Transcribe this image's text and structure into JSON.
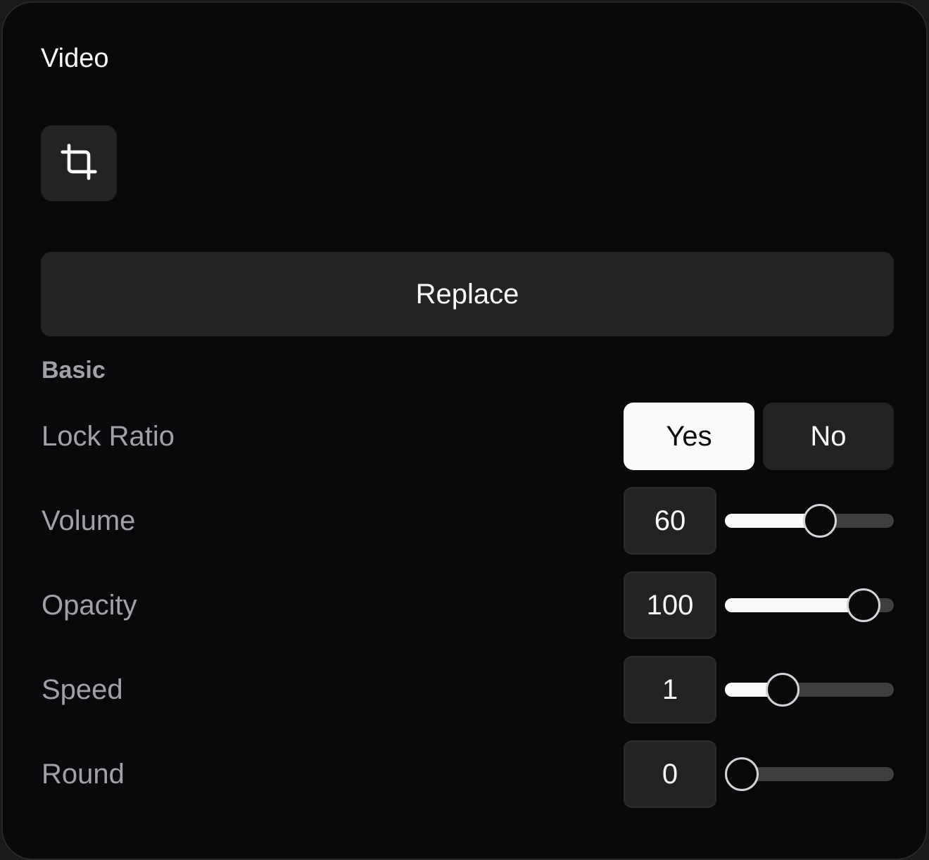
{
  "panel": {
    "title": "Video"
  },
  "toolbar": {
    "crop_icon": "crop-icon",
    "replace_label": "Replace"
  },
  "basic": {
    "section_title": "Basic",
    "lock_ratio": {
      "label": "Lock Ratio",
      "yes": "Yes",
      "no": "No",
      "selected": "Yes"
    },
    "volume": {
      "label": "Volume",
      "value": "60",
      "fraction": 0.58
    },
    "opacity": {
      "label": "Opacity",
      "value": "100",
      "fraction": 0.9
    },
    "speed": {
      "label": "Speed",
      "value": "1",
      "fraction": 0.3
    },
    "round": {
      "label": "Round",
      "value": "0",
      "fraction": 0.0
    }
  },
  "colors": {
    "background": "#09090b",
    "control": "#232325",
    "text": "#fafafa",
    "muted": "#a1a1aa",
    "track": "#3f3f42"
  }
}
